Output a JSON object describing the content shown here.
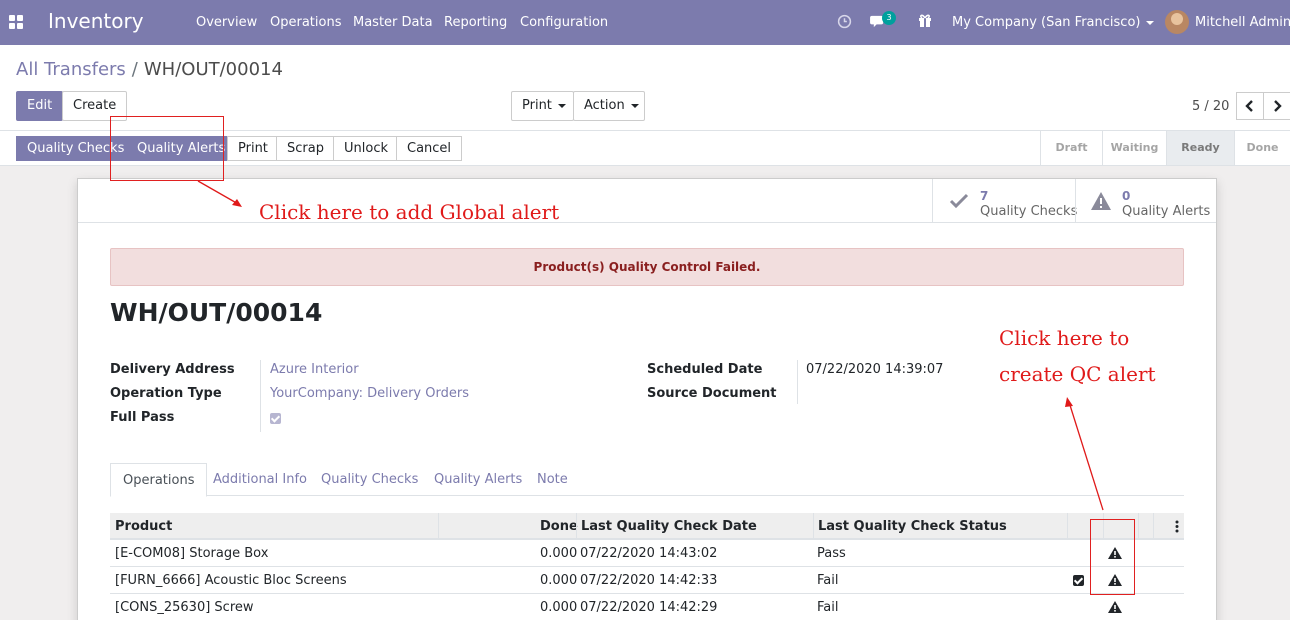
{
  "navbar": {
    "app_name": "Inventory",
    "menus": [
      "Overview",
      "Operations",
      "Master Data",
      "Reporting",
      "Configuration"
    ],
    "messages_count": "3",
    "company": "My Company (San Francisco)",
    "user": "Mitchell Admin",
    "icons": [
      "apps-icon",
      "clock-icon",
      "chat-icon",
      "gift-icon"
    ]
  },
  "breadcrumb": {
    "parent": "All Transfers",
    "separator": "/",
    "current": "WH/OUT/00014"
  },
  "toolbar": {
    "edit": "Edit",
    "create": "Create",
    "print": "Print",
    "action": "Action",
    "pager": "5 / 20"
  },
  "statusbar": {
    "buttons": [
      "Quality Checks",
      "Quality Alerts",
      "Print",
      "Scrap",
      "Unlock",
      "Cancel"
    ],
    "stages": [
      "Draft",
      "Waiting",
      "Ready",
      "Done"
    ],
    "active_stage": "Ready"
  },
  "smart_buttons": [
    {
      "count": "7",
      "label": "Quality Checks",
      "icon": "check-icon"
    },
    {
      "count": "0",
      "label": "Quality Alerts",
      "icon": "warning-icon"
    }
  ],
  "alert": "Product(s) Quality Control Failed.",
  "record_title": "WH/OUT/00014",
  "fields": {
    "delivery_address_label": "Delivery Address",
    "delivery_address": "Azure Interior",
    "operation_type_label": "Operation Type",
    "operation_type": "YourCompany: Delivery Orders",
    "full_pass_label": "Full Pass",
    "scheduled_date_label": "Scheduled Date",
    "scheduled_date": "07/22/2020 14:39:07",
    "source_document_label": "Source Document"
  },
  "tabs": [
    "Operations",
    "Additional Info",
    "Quality Checks",
    "Quality Alerts",
    "Note"
  ],
  "table": {
    "headers": [
      "Product",
      "Done",
      "Last Quality Check Date",
      "Last Quality Check Status"
    ],
    "rows": [
      {
        "product": "[E-COM08] Storage Box",
        "done": "0.000",
        "date": "07/22/2020 14:43:02",
        "status": "Pass",
        "checked": false
      },
      {
        "product": "[FURN_6666] Acoustic Bloc Screens",
        "done": "0.000",
        "date": "07/22/2020 14:42:33",
        "status": "Fail",
        "checked": true
      },
      {
        "product": "[CONS_25630] Screw",
        "done": "0.000",
        "date": "07/22/2020 14:42:29",
        "status": "Fail",
        "checked": false
      }
    ]
  },
  "annotations": {
    "global_alert": "Click here to add Global alert",
    "qc_alert_line1": "Click here to",
    "qc_alert_line2": "create QC alert",
    "color": "#e01a1a"
  },
  "colors": {
    "brand": "#7c7bad",
    "alert_bg": "#f2dede",
    "alert_text": "#8a1f1f"
  }
}
